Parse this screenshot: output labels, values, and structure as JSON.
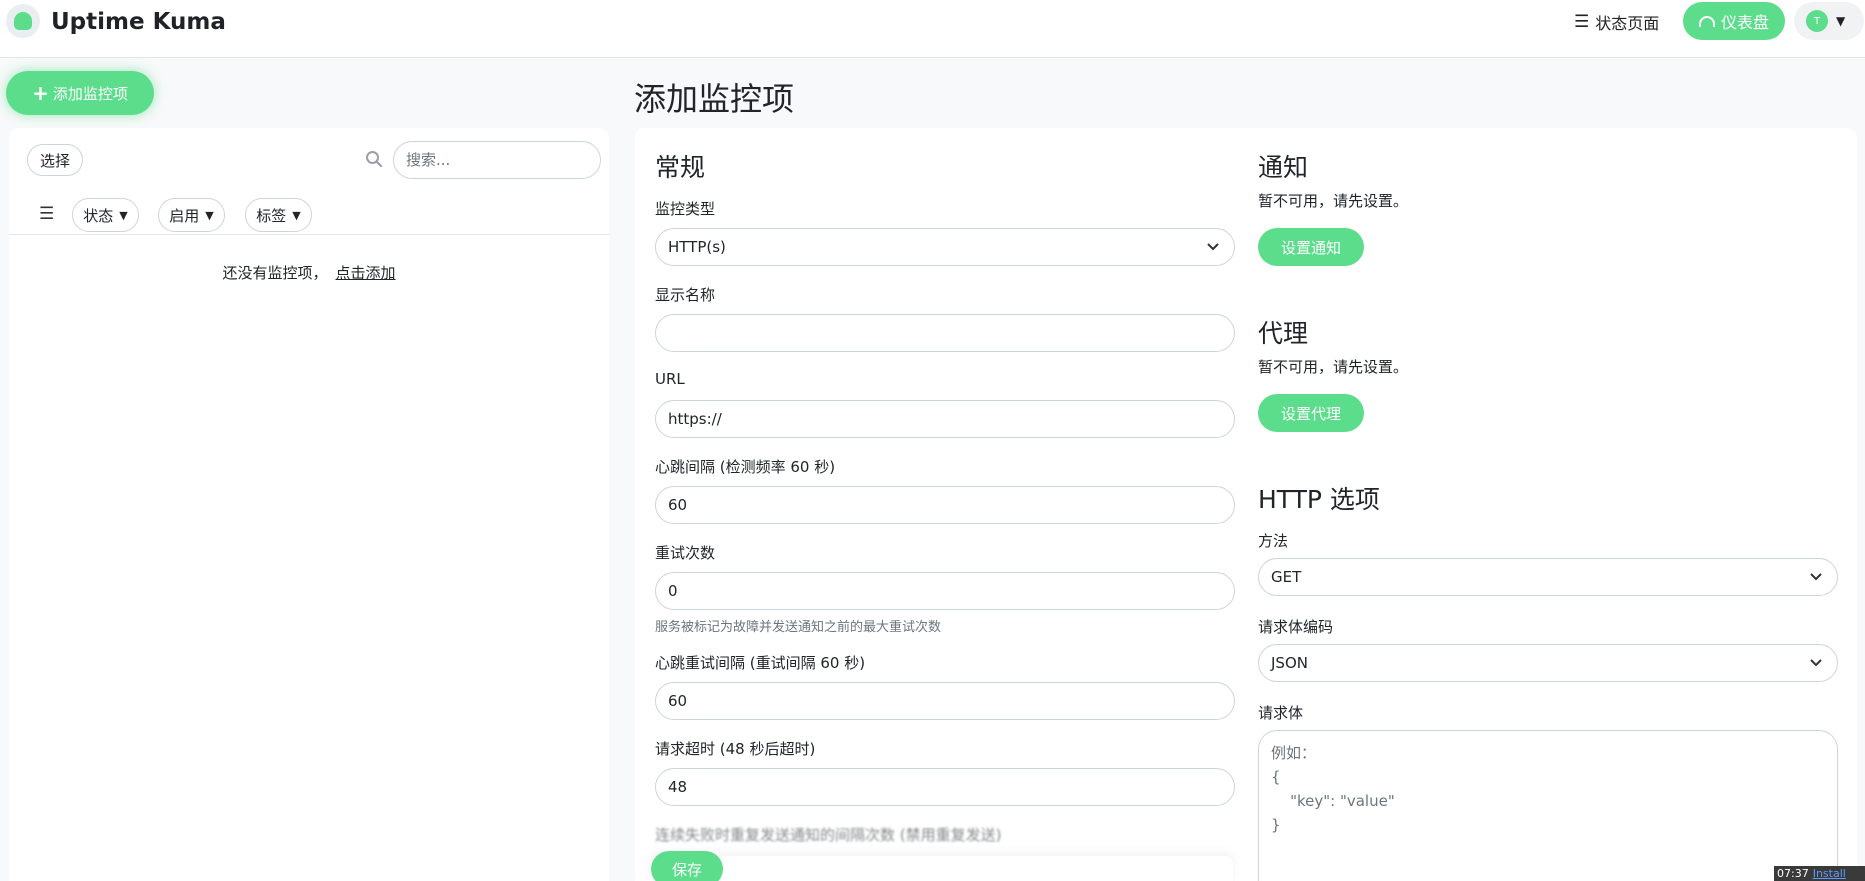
{
  "header": {
    "app_title": "Uptime Kuma",
    "status_page_label": "状态页面",
    "dashboard_label": "仪表盘",
    "avatar_initial": "T"
  },
  "sidebar": {
    "add_button_label": "添加监控项",
    "select_label": "选择",
    "search_placeholder": "搜索...",
    "filters": [
      "状态",
      "启用",
      "标签"
    ],
    "empty_text": "还没有监控项，",
    "empty_link": "点击添加"
  },
  "main": {
    "page_title": "添加监控项",
    "general": {
      "title": "常规",
      "monitor_type_label": "监控类型",
      "monitor_type_value": "HTTP(s)",
      "display_name_label": "显示名称",
      "display_name_value": "",
      "url_label": "URL",
      "url_value": "https://",
      "heartbeat_label": "心跳间隔 (检测频率 60 秒)",
      "heartbeat_value": "60",
      "retries_label": "重试次数",
      "retries_value": "0",
      "retries_help": "服务被标记为故障并发送通知之前的最大重试次数",
      "retry_interval_label": "心跳重试间隔 (重试间隔 60 秒)",
      "retry_interval_value": "60",
      "timeout_label": "请求超时 (48 秒后超时)",
      "timeout_value": "48",
      "resend_label": "连续失败时重复发送通知的间隔次数 (禁用重复发送)",
      "save_label": "保存"
    },
    "notification": {
      "title": "通知",
      "note": "暂不可用，请先设置。",
      "button": "设置通知"
    },
    "proxy": {
      "title": "代理",
      "note": "暂不可用，请先设置。",
      "button": "设置代理"
    },
    "http_options": {
      "title": "HTTP 选项",
      "method_label": "方法",
      "method_value": "GET",
      "body_encoding_label": "请求体编码",
      "body_encoding_value": "JSON",
      "body_label": "请求体",
      "body_placeholder": "例如：\n{\n    \"key\": \"value\"\n}"
    }
  },
  "taskbar": {
    "time": "07:37",
    "link": "Install"
  },
  "colors": {
    "accent": "#5cdd8b",
    "background": "#f8f9fa",
    "border": "#ced4da"
  }
}
